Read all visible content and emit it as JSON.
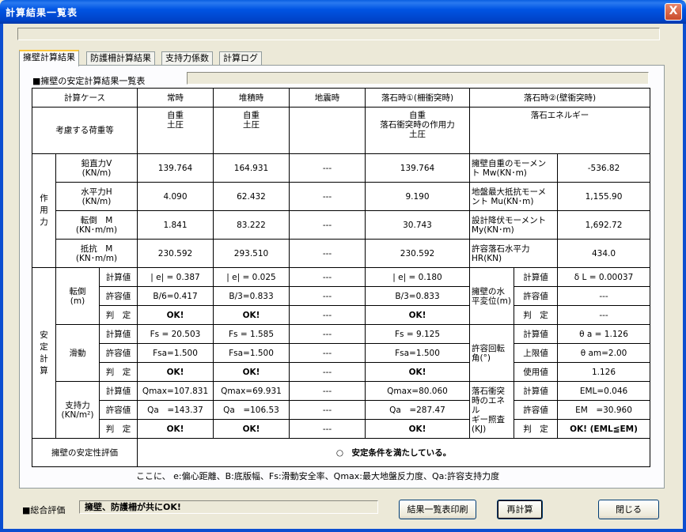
{
  "window": {
    "title": "計算結果一覧表",
    "close": "X"
  },
  "tabs": [
    "擁壁計算結果",
    "防護柵計算結果",
    "支持力係数",
    "計算ログ"
  ],
  "section_label": "■擁壁の安定計算結果一覧表",
  "table": {
    "header": {
      "case_label": "計算ケース",
      "cols": [
        "常時",
        "堆積時",
        "地震時",
        "落石時①(柵衝突時)",
        "落石時②(壁衝突時)"
      ]
    },
    "loads": {
      "label": "考慮する荷重等",
      "c1": [
        "自重",
        "土圧"
      ],
      "c2": [
        "自重",
        "土圧"
      ],
      "c4": [
        "自重",
        "落石衝突時の作用力",
        "土圧"
      ],
      "c5": [
        "落石エネルギー"
      ]
    },
    "action": {
      "group": [
        "作",
        "用",
        "力"
      ],
      "rows": [
        {
          "label": [
            "鉛直力V",
            "(KN/m)"
          ],
          "v1": "139.764",
          "v2": "164.931",
          "v3": "---",
          "v4": "139.764",
          "k5": [
            "擁壁自重のモーメン",
            "ト Mw(KN･m)"
          ],
          "v5": "-536.82"
        },
        {
          "label": [
            "水平力H",
            "(KN/m)"
          ],
          "v1": "4.090",
          "v2": "62.432",
          "v3": "---",
          "v4": "9.190",
          "k5": [
            "地盤最大抵抗モーメ",
            "ント Mu(KN･m)"
          ],
          "v5": "1,155.90"
        },
        {
          "label": [
            "転倒　M",
            "(KN･m/m)"
          ],
          "v1": "1.841",
          "v2": "83.222",
          "v3": "---",
          "v4": "30.743",
          "k5": [
            "設計降伏モーメント",
            "My(KN･m)"
          ],
          "v5": "1,692.72"
        },
        {
          "label": [
            "抵抗　M",
            "(KN･m/m)"
          ],
          "v1": "230.592",
          "v2": "293.510",
          "v3": "---",
          "v4": "230.592",
          "k5": [
            "許容落石水平力",
            "HR(KN)"
          ],
          "v5": "434.0"
        }
      ]
    },
    "stability": {
      "group": [
        "安",
        "定",
        "計",
        "算"
      ],
      "overturn": {
        "label": [
          "転倒",
          "(m)"
        ],
        "rows": [
          {
            "sub": "計算値",
            "v1": "| e| = 0.387",
            "v2": "| e| = 0.025",
            "v3": "---",
            "v4": "| e| = 0.180"
          },
          {
            "sub": "許容値",
            "v1": "B/6=0.417",
            "v2": "B/3=0.833",
            "v3": "---",
            "v4": "B/3=0.833"
          },
          {
            "sub": "判　定",
            "v1": "OK!",
            "v2": "OK!",
            "v3": "---",
            "v4": "OK!"
          }
        ],
        "right_label": [
          "擁壁の水",
          "平変位(m)"
        ],
        "right_rows": [
          {
            "sub": "計算値",
            "val": "δ L = 0.00037"
          },
          {
            "sub": "許容値",
            "val": "---"
          },
          {
            "sub": "判　定",
            "val": "---"
          }
        ]
      },
      "sliding": {
        "label": [
          "滑動"
        ],
        "rows": [
          {
            "sub": "計算値",
            "v1": "Fs = 20.503",
            "v2": "Fs = 1.585",
            "v3": "---",
            "v4": "Fs = 9.125"
          },
          {
            "sub": "許容値",
            "v1": "Fsa=1.500",
            "v2": "Fsa=1.500",
            "v3": "---",
            "v4": "Fsa=1.500"
          },
          {
            "sub": "判　定",
            "v1": "OK!",
            "v2": "OK!",
            "v3": "---",
            "v4": "OK!"
          }
        ],
        "right_label": [
          "許容回転",
          "角(°)"
        ],
        "right_rows": [
          {
            "sub": "計算値",
            "val": "θ a = 1.126"
          },
          {
            "sub": "上限値",
            "val": "θ am=2.00"
          },
          {
            "sub": "使用値",
            "val": "1.126"
          }
        ]
      },
      "bearing": {
        "label": [
          "支持力",
          "(KN/m²)"
        ],
        "rows": [
          {
            "sub": "計算値",
            "v1": "Qmax=107.831",
            "v2": "Qmax=69.931",
            "v3": "---",
            "v4": "Qmax=80.060"
          },
          {
            "sub": "許容値",
            "v1": "Qa　=143.37",
            "v2": "Qa　=106.53",
            "v3": "---",
            "v4": "Qa　=287.47"
          },
          {
            "sub": "判　定",
            "v1": "OK!",
            "v2": "OK!",
            "v3": "---",
            "v4": "OK!"
          }
        ],
        "right_label": [
          "落石衝突",
          "時のエネル",
          "ギー照査",
          "(KJ)"
        ],
        "right_rows": [
          {
            "sub": "計算値",
            "val": "EML=0.046"
          },
          {
            "sub": "許容値",
            "val": "EM　=30.960"
          },
          {
            "sub": "判　定",
            "val": "OK! (EML≦EM)"
          }
        ]
      }
    },
    "evaluation": {
      "label": "擁壁の安定性評価",
      "value": "○　安定条件を満たしている。"
    }
  },
  "note": "ここに、 e:偏心距離、B:底版幅、Fs:滑動安全率、Qmax:最大地盤反力度、Qa:許容支持力度",
  "footer": {
    "label": "■総合評価",
    "value": "擁壁、防護柵が共にOK!",
    "buttons": {
      "print": "結果一覧表印刷",
      "recalc": "再計算",
      "close": "閉じる"
    }
  }
}
